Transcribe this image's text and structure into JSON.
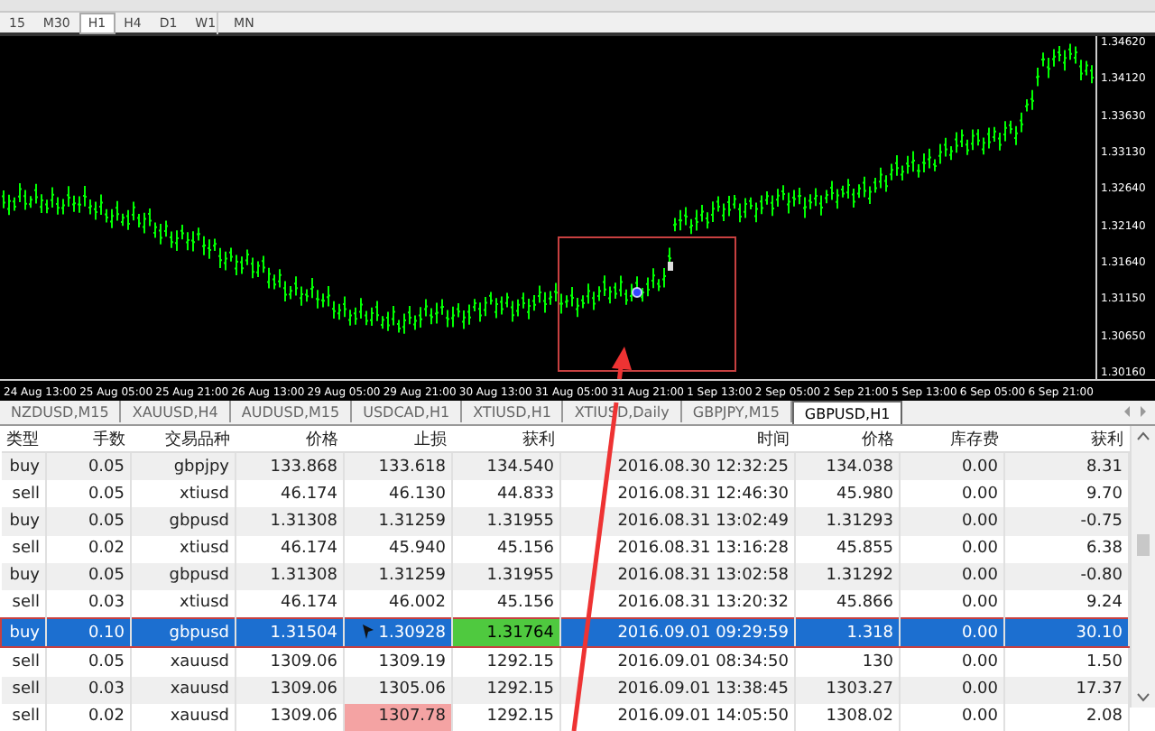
{
  "timeframes": [
    {
      "label": "15",
      "selected": false
    },
    {
      "label": "M30",
      "selected": false
    },
    {
      "label": "H1",
      "selected": true
    },
    {
      "label": "H4",
      "selected": false
    },
    {
      "label": "D1",
      "selected": false
    },
    {
      "label": "W1",
      "selected": false
    },
    {
      "label": "MN",
      "selected": false
    }
  ],
  "chart": {
    "price_labels": [
      "1.34620",
      "1.34120",
      "1.33630",
      "1.33130",
      "1.32640",
      "1.32140",
      "1.31640",
      "1.31150",
      "1.30650",
      "1.30160"
    ],
    "time_labels": [
      "24 Aug 13:00",
      "25 Aug 05:00",
      "25 Aug 21:00",
      "26 Aug 13:00",
      "29 Aug 05:00",
      "29 Aug 21:00",
      "30 Aug 13:00",
      "31 Aug 05:00",
      "31 Aug 21:00",
      "1 Sep 13:00",
      "2 Sep 05:00",
      "2 Sep 21:00",
      "5 Sep 13:00",
      "6 Sep 05:00",
      "6 Sep 21:00"
    ]
  },
  "chart_tabs": [
    {
      "label": "NZDUSD,M15",
      "selected": false
    },
    {
      "label": "XAUUSD,H4",
      "selected": false
    },
    {
      "label": "AUDUSD,M15",
      "selected": false
    },
    {
      "label": "USDCAD,H1",
      "selected": false
    },
    {
      "label": "XTIUSD,H1",
      "selected": false
    },
    {
      "label": "XTIUSD,Daily",
      "selected": false
    },
    {
      "label": "GBPJPY,M15",
      "selected": false
    },
    {
      "label": "GBPUSD,H1",
      "selected": true
    }
  ],
  "table": {
    "columns": [
      "类型",
      "手数",
      "交易品种",
      "价格",
      "止损",
      "获利",
      "时间",
      "价格",
      "库存费",
      "获利"
    ],
    "rows": [
      {
        "cells": [
          "buy",
          "0.05",
          "gbpjpy",
          "133.868",
          "133.618",
          "134.540",
          "2016.08.30 12:32:25",
          "134.038",
          "0.00",
          "8.31"
        ],
        "selected": false,
        "sl_alert": false,
        "tp_alert": false
      },
      {
        "cells": [
          "sell",
          "0.05",
          "xtiusd",
          "46.174",
          "46.130",
          "44.833",
          "2016.08.31 12:46:30",
          "45.980",
          "0.00",
          "9.70"
        ],
        "selected": false,
        "sl_alert": false,
        "tp_alert": false
      },
      {
        "cells": [
          "buy",
          "0.05",
          "gbpusd",
          "1.31308",
          "1.31259",
          "1.31955",
          "2016.08.31 13:02:49",
          "1.31293",
          "0.00",
          "-0.75"
        ],
        "selected": false,
        "sl_alert": false,
        "tp_alert": false
      },
      {
        "cells": [
          "sell",
          "0.02",
          "xtiusd",
          "46.174",
          "45.940",
          "45.156",
          "2016.08.31 13:16:28",
          "45.855",
          "0.00",
          "6.38"
        ],
        "selected": false,
        "sl_alert": false,
        "tp_alert": false
      },
      {
        "cells": [
          "buy",
          "0.05",
          "gbpusd",
          "1.31308",
          "1.31259",
          "1.31955",
          "2016.08.31 13:02:58",
          "1.31292",
          "0.00",
          "-0.80"
        ],
        "selected": false,
        "sl_alert": false,
        "tp_alert": false
      },
      {
        "cells": [
          "sell",
          "0.03",
          "xtiusd",
          "46.174",
          "46.002",
          "45.156",
          "2016.08.31 13:20:32",
          "45.866",
          "0.00",
          "9.24"
        ],
        "selected": false,
        "sl_alert": false,
        "tp_alert": false
      },
      {
        "cells": [
          "buy",
          "0.10",
          "gbpusd",
          "1.31504",
          "1.30928",
          "1.31764",
          "2016.09.01 09:29:59",
          "1.318",
          "0.00",
          "30.10"
        ],
        "selected": true,
        "sl_alert": false,
        "tp_alert": true
      },
      {
        "cells": [
          "sell",
          "0.05",
          "xauusd",
          "1309.06",
          "1309.19",
          "1292.15",
          "2016.09.01 08:34:50",
          "130",
          "0.00",
          "1.50"
        ],
        "selected": false,
        "sl_alert": false,
        "tp_alert": false
      },
      {
        "cells": [
          "sell",
          "0.03",
          "xauusd",
          "1309.06",
          "1305.06",
          "1292.15",
          "2016.09.01 13:38:45",
          "1303.27",
          "0.00",
          "17.37"
        ],
        "selected": false,
        "sl_alert": false,
        "tp_alert": false
      },
      {
        "cells": [
          "sell",
          "0.02",
          "xauusd",
          "1309.06",
          "1307.78",
          "1292.15",
          "2016.09.01 14:05:50",
          "1308.02",
          "0.00",
          "2.08"
        ],
        "selected": false,
        "sl_alert": true,
        "tp_alert": false
      }
    ]
  }
}
